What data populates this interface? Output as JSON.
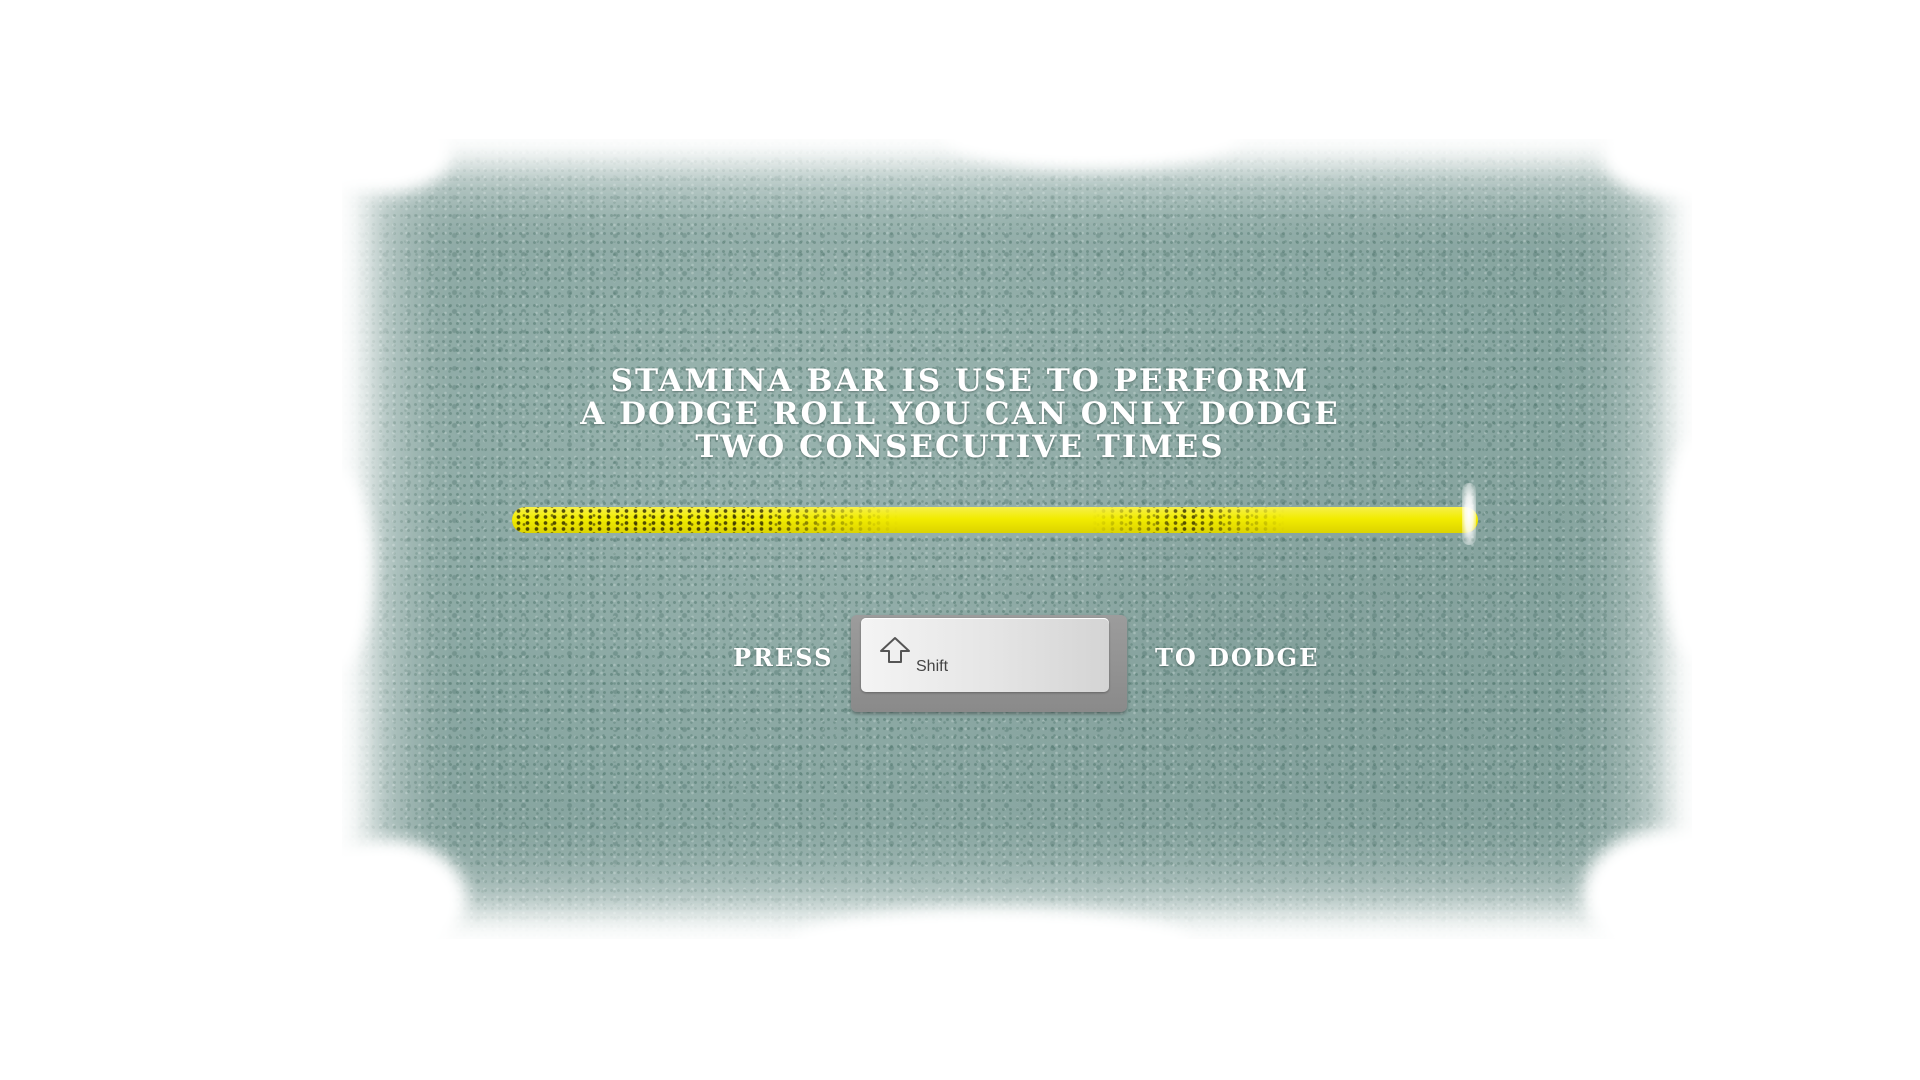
{
  "tutorial": {
    "title_lines": [
      "STAMINA BAR IS USE TO PERFORM",
      "A DODGE ROLL YOU CAN ONLY DODGE",
      "TWO CONSECUTIVE TIMES"
    ],
    "press_label": "PRESS",
    "key_label": "Shift",
    "key_icon": "shift-arrow-icon",
    "action_label": "TO DODGE"
  },
  "stamina": {
    "level": 1.0,
    "color": "#f2ec00"
  },
  "colors": {
    "panel": "#8fa9a5",
    "frost": "#ffffff",
    "text": "#ffffff"
  }
}
